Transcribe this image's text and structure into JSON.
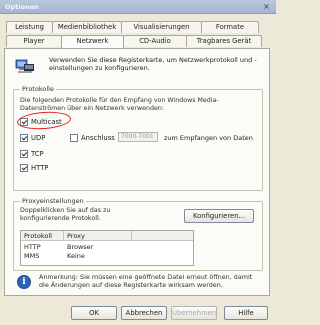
{
  "window": {
    "title": "Optionen",
    "close_glyph": "×"
  },
  "tabs_row1": [
    {
      "label": "Leistung"
    },
    {
      "label": "Medienbibliothek"
    },
    {
      "label": "Visualisierungen"
    },
    {
      "label": "Formate"
    }
  ],
  "tabs_row2": [
    {
      "label": "Player"
    },
    {
      "label": "Netzwerk",
      "active": true
    },
    {
      "label": "CD-Audio"
    },
    {
      "label": "Tragbares Gerät"
    }
  ],
  "intro": {
    "text": "Verwenden Sie diese Registerkarte, um Netzwerkprotokoll und -einstellungen zu konfigurieren.",
    "icon": "network-settings-icon"
  },
  "protocols": {
    "legend": "Protokolle",
    "description": "Die folgenden Protokolle für den Empfang von Windows Media-Datenströmen über ein Netzwerk verwenden:",
    "items": [
      {
        "label": "Multicast",
        "checked": true
      },
      {
        "label": "UDP",
        "checked": true
      },
      {
        "label": "TCP",
        "checked": true
      },
      {
        "label": "HTTP",
        "checked": true
      }
    ],
    "ports_label": "Anschluss",
    "ports_value": "7000-7001",
    "ports_suffix": "zum Empfangen von Daten",
    "highlight_color": "#e11d1d"
  },
  "proxy": {
    "legend": "Proxyeinstellungen",
    "description": "Doppelklicken Sie auf das zu konfigurierende Protokoll.",
    "configure_button": "Konfigurieren...",
    "columns": [
      "Protokoll",
      "Proxy"
    ],
    "rows": [
      {
        "protocol": "HTTP",
        "proxy": "Browser"
      },
      {
        "protocol": "MMS",
        "proxy": "Keine"
      }
    ]
  },
  "note": {
    "text": "Anmerkung: Sie müssen eine geöffnete Datei erneut öffnen, damit die Änderungen auf diese Registerkarte wirksam werden.",
    "icon": "info-icon"
  },
  "buttons": {
    "ok": "OK",
    "cancel": "Abbrechen",
    "apply": "Übernehmen",
    "help": "Hilfe"
  }
}
